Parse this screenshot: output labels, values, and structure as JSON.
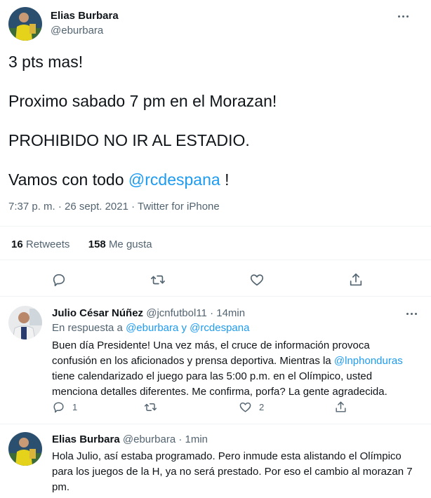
{
  "main_tweet": {
    "author_name": "Elias Burbara",
    "author_handle": "@eburbara",
    "text_lines": [
      "3 pts mas!",
      "Proximo sabado 7 pm en el Morazan!",
      "PROHIBIDO NO IR AL ESTADIO.",
      "Vamos con todo",
      "@rcdespana",
      "!"
    ],
    "meta": "7:37 p. m. · 26 sept. 2021 · Twitter for iPhone",
    "retweets_count": "16",
    "retweets_label": "Retweets",
    "likes_count": "158",
    "likes_label": "Me gusta"
  },
  "replies": [
    {
      "author_name": "Julio César Núñez",
      "author_handle": "@jcnfutbol11",
      "time": "· 14min",
      "reply_prefix": "En respuesta a",
      "reply_to": "@eburbara y @rcdespana",
      "lines": [
        "Buen día Presidente! Una vez más, el cruce de información provoca",
        "confusión en los aficionados y prensa deportiva. Mientras la",
        "@lnphonduras",
        "tiene calendarizado el juego para las 5:00 p.m. en el Olímpico, usted",
        "menciona detalles diferentes. Me confirma, porfa? La gente agradecida."
      ],
      "reply_count": "1",
      "like_count": "2"
    },
    {
      "author_name": "Elias Burbara",
      "author_handle": "@eburbara",
      "time": "· 1min",
      "lines": [
        "Hola Julio, así estaba programado. Pero inmude esta alistando el Olímpico",
        "para los juegos de la H, ya no será prestado. Por eso el cambio al morazan 7",
        "pm."
      ]
    }
  ],
  "colors": {
    "text": "#0f1419",
    "muted": "#536471",
    "link": "#1d9bf0",
    "divider": "#eff3f4"
  },
  "icons": [
    "more-icon",
    "reply-icon",
    "retweet-icon",
    "like-icon",
    "share-icon"
  ]
}
